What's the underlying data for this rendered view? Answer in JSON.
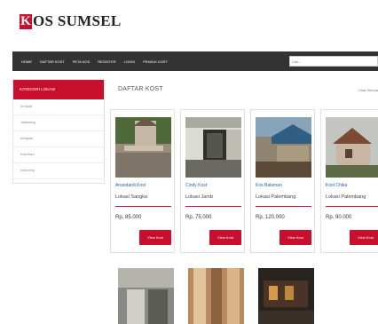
{
  "logo": {
    "mark": "K",
    "text": "OS SUMSEL"
  },
  "nav": {
    "items": [
      "HOME",
      "DAFTAR KOST",
      "PETA KOS",
      "REGISTER",
      "LOGIN",
      "PEMILIK KOST"
    ],
    "search_placeholder": "Cari..."
  },
  "sidebar": {
    "title": "KATEGORI LOKASI",
    "items": [
      "Ilir Barat",
      "Jakabaring",
      "Kertapati",
      "Kota Baru",
      "Kemuning"
    ]
  },
  "content": {
    "title": "DAFTAR KOST",
    "link": "Lihat Semua"
  },
  "cards": [
    {
      "name": "Anandardi Kost",
      "location": "Lokasi Sangka",
      "price": "Rp. 85.000",
      "button": "View Kost"
    },
    {
      "name": "Cindy Kost",
      "location": "Lokasi Jamb",
      "price": "Rp. 75.000",
      "button": "View Kost"
    },
    {
      "name": "Kos Balaman",
      "location": "Lokasi Palembang",
      "price": "Rp. 120.000",
      "button": "View Kost"
    },
    {
      "name": "Kost Chika",
      "location": "Lokasi Palembang",
      "price": "Rp. 90.000",
      "button": "View Kost"
    }
  ]
}
